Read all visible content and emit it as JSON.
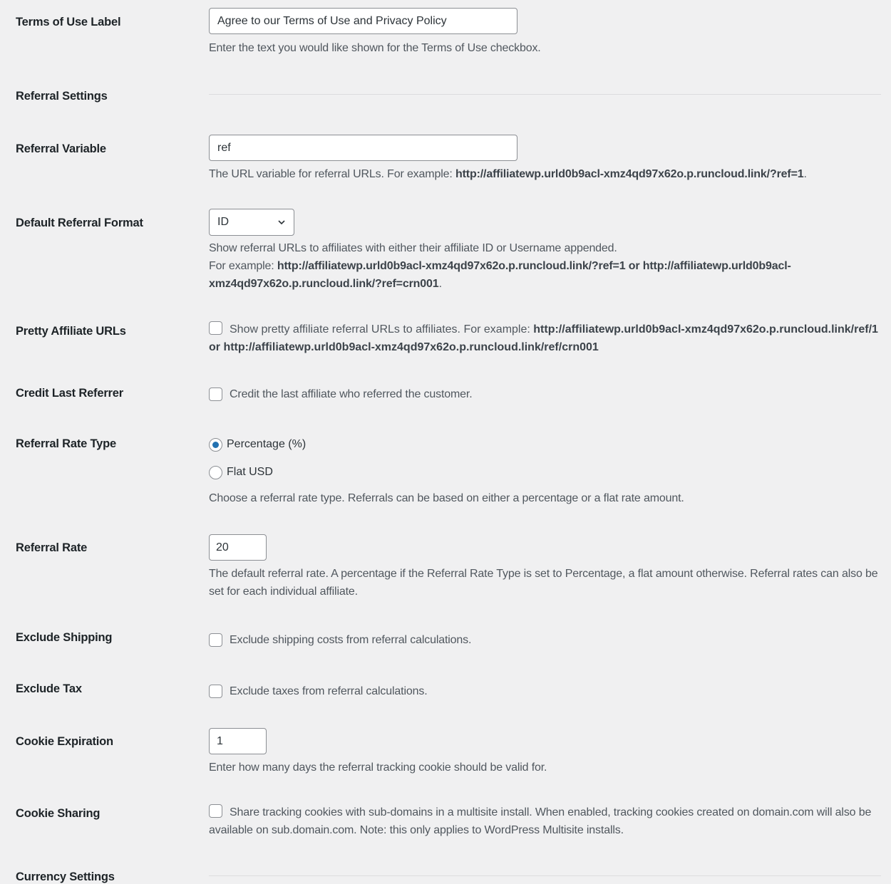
{
  "fields": {
    "terms_label": {
      "label": "Terms of Use Label",
      "value": "Agree to our Terms of Use and Privacy Policy",
      "description": "Enter the text you would like shown for the Terms of Use checkbox."
    },
    "referral_settings": {
      "heading": "Referral Settings"
    },
    "referral_variable": {
      "label": "Referral Variable",
      "value": "ref",
      "description_prefix": "The URL variable for referral URLs. For example: ",
      "description_url": "http://affiliatewp.urld0b9acl-xmz4qd97x62o.p.runcloud.link/?ref=1",
      "description_suffix": "."
    },
    "default_referral_format": {
      "label": "Default Referral Format",
      "selected": "ID",
      "description_line1": "Show referral URLs to affiliates with either their affiliate ID or Username appended.",
      "description_prefix": "For example: ",
      "description_urls": "http://affiliatewp.urld0b9acl-xmz4qd97x62o.p.runcloud.link/?ref=1 or http://affiliatewp.urld0b9acl-xmz4qd97x62o.p.runcloud.link/?ref=crn001",
      "description_suffix": "."
    },
    "pretty_affiliate_urls": {
      "label": "Pretty Affiliate URLs",
      "checked": false,
      "text_prefix": "Show pretty affiliate referral URLs to affiliates. For example: ",
      "text_urls": "http://affiliatewp.urld0b9acl-xmz4qd97x62o.p.runcloud.link/ref/1 or http://affiliatewp.urld0b9acl-xmz4qd97x62o.p.runcloud.link/ref/crn001"
    },
    "credit_last_referrer": {
      "label": "Credit Last Referrer",
      "checked": false,
      "text": "Credit the last affiliate who referred the customer."
    },
    "referral_rate_type": {
      "label": "Referral Rate Type",
      "options": [
        {
          "label": "Percentage (%)",
          "checked": true
        },
        {
          "label": "Flat USD",
          "checked": false
        }
      ],
      "description": "Choose a referral rate type. Referrals can be based on either a percentage or a flat rate amount."
    },
    "referral_rate": {
      "label": "Referral Rate",
      "value": "20",
      "description": "The default referral rate. A percentage if the Referral Rate Type is set to Percentage, a flat amount otherwise. Referral rates can also be set for each individual affiliate."
    },
    "exclude_shipping": {
      "label": "Exclude Shipping",
      "checked": false,
      "text": "Exclude shipping costs from referral calculations."
    },
    "exclude_tax": {
      "label": "Exclude Tax",
      "checked": false,
      "text": "Exclude taxes from referral calculations."
    },
    "cookie_expiration": {
      "label": "Cookie Expiration",
      "value": "1",
      "description": "Enter how many days the referral tracking cookie should be valid for."
    },
    "cookie_sharing": {
      "label": "Cookie Sharing",
      "checked": false,
      "text": "Share tracking cookies with sub-domains in a multisite install. When enabled, tracking cookies created on domain.com will also be available on sub.domain.com. Note: this only applies to WordPress Multisite installs."
    },
    "currency_settings": {
      "heading": "Currency Settings"
    }
  },
  "colors": {
    "background": "#f0f0f1",
    "accent": "#2271b1",
    "label": "#1d2327",
    "description": "#50575e",
    "border": "#8c8f94"
  }
}
